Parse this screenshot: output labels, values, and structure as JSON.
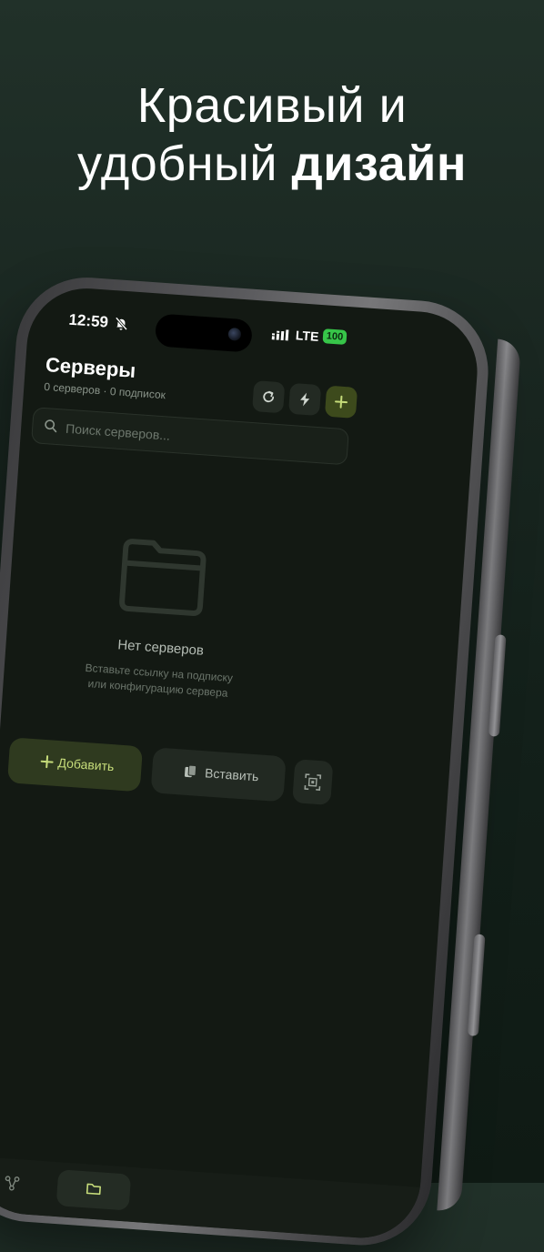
{
  "promo": {
    "headline_line1": "Красивый и",
    "headline_line2_regular": "удобный",
    "headline_line2_bold": "дизайн"
  },
  "status_bar": {
    "time": "12:59",
    "network": "LTE",
    "battery": "100"
  },
  "header": {
    "title": "Серверы",
    "subtitle": "0 серверов · 0 подписок"
  },
  "toolbar": {
    "refresh_icon": "refresh-icon",
    "bolt_icon": "bolt-icon",
    "add_icon": "plus-icon"
  },
  "search": {
    "placeholder": "Поиск серверов..."
  },
  "empty_state": {
    "title": "Нет серверов",
    "hint_line1": "Вставьте ссылку на подписку",
    "hint_line2": "или конфигурацию сервера"
  },
  "actions": {
    "add_label": "Добавить",
    "paste_label": "Вставить"
  },
  "colors": {
    "accent": "#c6dc7a",
    "background": "#131913"
  }
}
